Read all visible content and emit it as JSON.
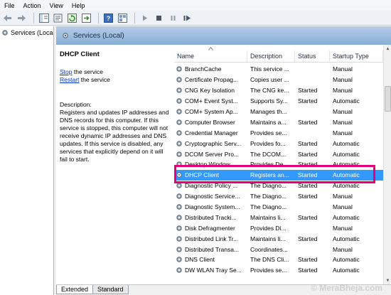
{
  "menubar": {
    "items": [
      "File",
      "Action",
      "View",
      "Help"
    ]
  },
  "toolbar": {
    "icons": [
      "back-arrow-icon",
      "forward-arrow-icon",
      "show-tree-icon",
      "properties-icon",
      "refresh-icon",
      "export-icon",
      "help-icon",
      "view-icon",
      "start-icon",
      "stop-icon",
      "pause-icon",
      "restart-icon"
    ]
  },
  "tree": {
    "item": "Services (Local"
  },
  "header": {
    "title": "Services (Local)"
  },
  "description": {
    "title": "DHCP Client",
    "stop_link": "Stop",
    "stop_suffix": " the service",
    "restart_link": "Restart",
    "restart_suffix": " the service",
    "label": "Description:",
    "text": "Registers and updates IP addresses and DNS records for this computer. If this service is stopped, this computer will not receive dynamic IP addresses and DNS updates. If this service is disabled, any services that explicitly depend on it will fail to start."
  },
  "columns": [
    "Name",
    "Description",
    "Status",
    "Startup Type"
  ],
  "rows": [
    {
      "name": "BranchCache",
      "desc": "This service ...",
      "status": "",
      "startup": "Manual"
    },
    {
      "name": "Certificate Propag...",
      "desc": "Copies user ...",
      "status": "",
      "startup": "Manual"
    },
    {
      "name": "CNG Key Isolation",
      "desc": "The CNG ke...",
      "status": "Started",
      "startup": "Manual"
    },
    {
      "name": "COM+ Event Syst...",
      "desc": "Supports Sy...",
      "status": "Started",
      "startup": "Automatic"
    },
    {
      "name": "COM+ System Ap...",
      "desc": "Manages th...",
      "status": "",
      "startup": "Manual"
    },
    {
      "name": "Computer Browser",
      "desc": "Maintains a...",
      "status": "Started",
      "startup": "Manual"
    },
    {
      "name": "Credential Manager",
      "desc": "Provides se...",
      "status": "",
      "startup": "Manual"
    },
    {
      "name": "Cryptographic Serv...",
      "desc": "Provides fo...",
      "status": "Started",
      "startup": "Automatic"
    },
    {
      "name": "DCOM Server Pro...",
      "desc": "The DCOM...",
      "status": "Started",
      "startup": "Automatic"
    },
    {
      "name": "Desktop Window...",
      "desc": "Provides De...",
      "status": "Started",
      "startup": "Automatic"
    },
    {
      "name": "DHCP Client",
      "desc": "Registers an...",
      "status": "Started",
      "startup": "Automatic",
      "selected": true
    },
    {
      "name": "Diagnostic Policy ...",
      "desc": "The Diagno...",
      "status": "Started",
      "startup": "Automatic"
    },
    {
      "name": "Diagnostic Service...",
      "desc": "The Diagno...",
      "status": "Started",
      "startup": "Manual"
    },
    {
      "name": "Diagnostic System...",
      "desc": "The Diagno...",
      "status": "",
      "startup": "Manual"
    },
    {
      "name": "Distributed Tracki...",
      "desc": "Maintains li...",
      "status": "Started",
      "startup": "Automatic"
    },
    {
      "name": "Disk Defragmenter",
      "desc": "Provides Di...",
      "status": "",
      "startup": "Manual"
    },
    {
      "name": "Distributed Link Tr...",
      "desc": "Maintains li...",
      "status": "Started",
      "startup": "Automatic"
    },
    {
      "name": "Distributed Transa...",
      "desc": "Coordinates...",
      "status": "",
      "startup": "Manual"
    },
    {
      "name": "DNS Client",
      "desc": "The DNS Cli...",
      "status": "Started",
      "startup": "Automatic"
    },
    {
      "name": "DW WLAN Tray Se...",
      "desc": "Provides se...",
      "status": "Started",
      "startup": "Automatic"
    }
  ],
  "tabs": [
    "Extended",
    "Standard"
  ],
  "watermark": "© MeraBheja.com",
  "colors": {
    "selected_row": "#3399ff",
    "highlight": "#e6007e",
    "header_band": "#88aed6"
  }
}
